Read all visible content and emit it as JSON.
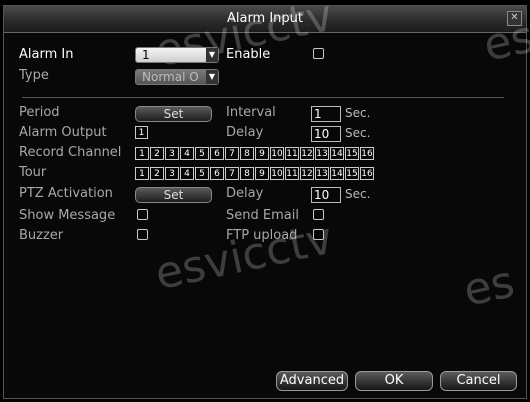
{
  "window": {
    "title": "Alarm Input",
    "close_glyph": "✕"
  },
  "watermarks": [
    "esvicctv",
    "esvicctv",
    "es",
    "esvicctv",
    "es",
    "esv",
    "esv"
  ],
  "alarm_in": {
    "label": "Alarm In",
    "value": "1"
  },
  "enable": {
    "label": "Enable"
  },
  "type": {
    "label": "Type",
    "value": "Normal O"
  },
  "period": {
    "label": "Period",
    "button": "Set"
  },
  "interval": {
    "label": "Interval",
    "value": "1",
    "unit": "Sec."
  },
  "alarm_output": {
    "label": "Alarm Output",
    "value": "1"
  },
  "delay1": {
    "label": "Delay",
    "value": "10",
    "unit": "Sec."
  },
  "record_channel": {
    "label": "Record Channel",
    "channels": [
      "1",
      "2",
      "3",
      "4",
      "5",
      "6",
      "7",
      "8",
      "9",
      "10",
      "11",
      "12",
      "13",
      "14",
      "15",
      "16"
    ]
  },
  "tour": {
    "label": "Tour",
    "channels": [
      "1",
      "2",
      "3",
      "4",
      "5",
      "6",
      "7",
      "8",
      "9",
      "10",
      "11",
      "12",
      "13",
      "14",
      "15",
      "16"
    ]
  },
  "ptz_activation": {
    "label": "PTZ Activation",
    "button": "Set"
  },
  "delay2": {
    "label": "Delay",
    "value": "10",
    "unit": "Sec."
  },
  "show_message": {
    "label": "Show Message"
  },
  "send_email": {
    "label": "Send Email"
  },
  "buzzer": {
    "label": "Buzzer"
  },
  "ftp_upload": {
    "label": "FTP upload"
  },
  "buttons": {
    "advanced": "Advanced",
    "ok": "OK",
    "cancel": "Cancel"
  }
}
